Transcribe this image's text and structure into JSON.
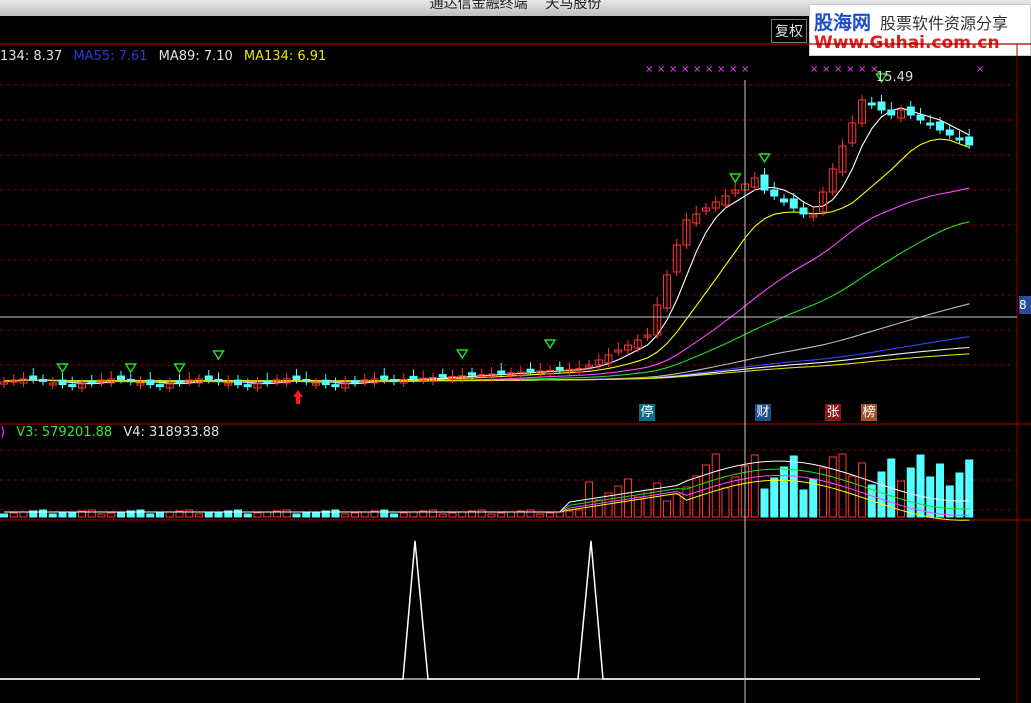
{
  "window": {
    "title": "通达信金融终端    天马股份"
  },
  "toolbar": {
    "fuquan_button": "复权"
  },
  "watermark": {
    "site_name": "股海网",
    "slogan": "股票软件资源分享",
    "url": "Www.Guhai.com.cn"
  },
  "main_panel": {
    "ma_legend": [
      {
        "label": "134: 8.37",
        "color": "#e0e0e0"
      },
      {
        "label": "MA55: 7.61",
        "color": "#2f35d8"
      },
      {
        "label": "MA89: 7.10",
        "color": "#e0e0e0"
      },
      {
        "label": "MA134: 6.91",
        "color": "#e8e800"
      }
    ],
    "peak_label": "15.49",
    "axis_label": "8",
    "event_tags": [
      {
        "text": "停",
        "bg": "#0c6f8a"
      },
      {
        "text": "财",
        "bg": "#1f4f8f"
      },
      {
        "text": "张",
        "bg": "#8a1a1a"
      },
      {
        "text": "榜",
        "bg": "#a0522d"
      }
    ]
  },
  "volume_panel": {
    "legend": [
      {
        "label": ")",
        "color": "#ff3cff"
      },
      {
        "label": "V3: 579201.88",
        "color": "#2ee82e"
      },
      {
        "label": "V4: 318933.88",
        "color": "#e0e0e0"
      }
    ]
  },
  "colors": {
    "up": "#ff3232",
    "down": "#54ffff",
    "grid": "#8b0000",
    "crosshair": "#c8c8c8"
  }
}
